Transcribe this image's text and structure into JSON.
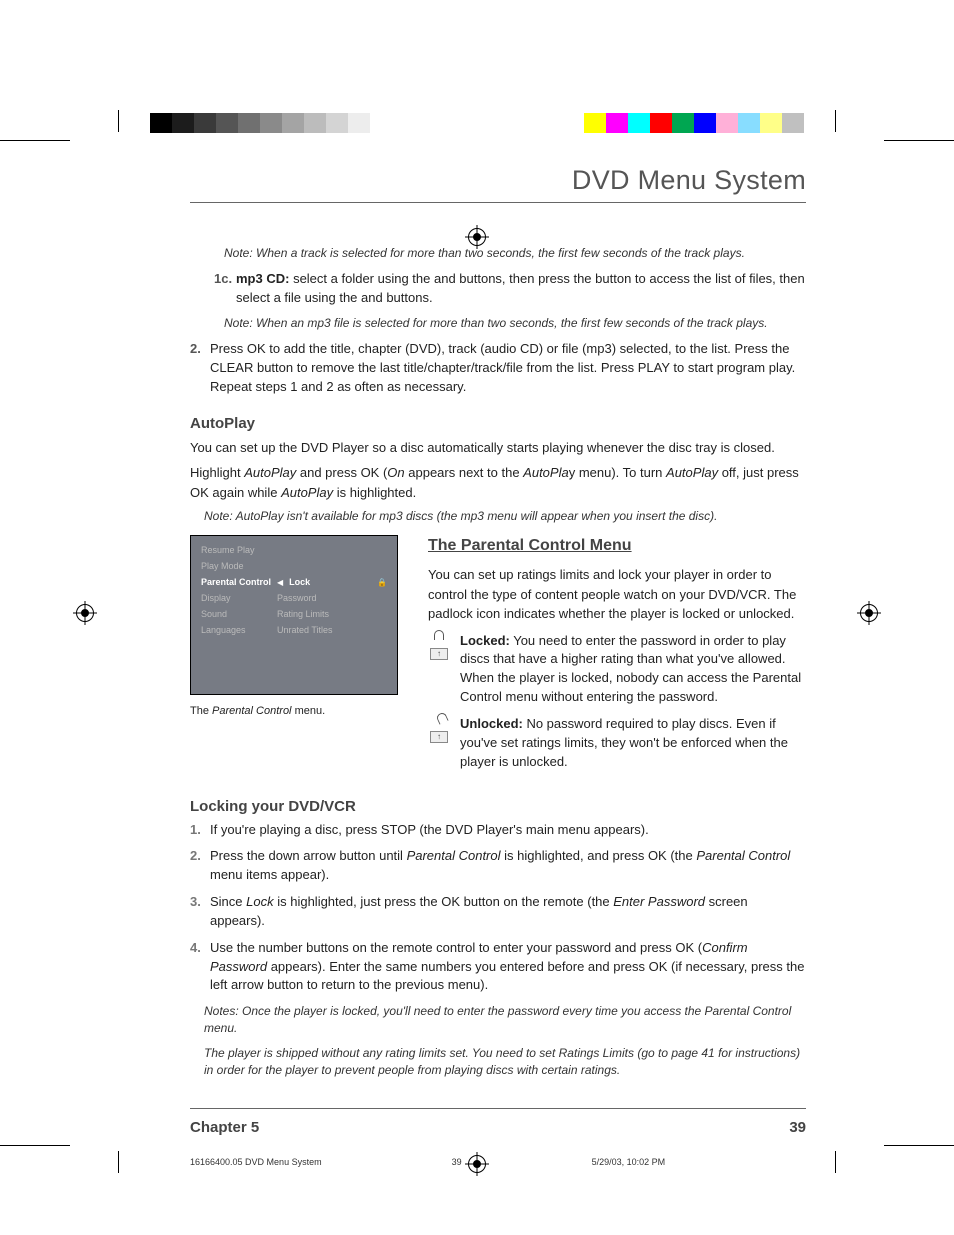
{
  "header": {
    "title": "DVD Menu System"
  },
  "intro": {
    "note1": "Note: When a track is selected for more than two seconds, the first few seconds of the track plays.",
    "step1c_label": "1c.",
    "step1c_pre": "mp3 CD:",
    "step1c_text": " select a folder using the and buttons, then press the button to access the list of files, then select a file using the and buttons.",
    "note2": "Note: When an mp3 file is selected for more than two seconds, the first few seconds of the track plays.",
    "step2_label": "2.",
    "step2_text": "Press OK to add the title, chapter (DVD), track (audio CD) or file (mp3) selected, to the list. Press the CLEAR button to remove the last title/chapter/track/file from the list. Press PLAY to start program play. Repeat steps 1 and 2 as often as necessary."
  },
  "autoplay": {
    "heading": "AutoPlay",
    "p1": "You can set up the DVD Player so a disc automatically starts playing whenever the disc tray is closed.",
    "p2_a": "Highlight ",
    "p2_b": "AutoPlay",
    "p2_c": " and press OK (",
    "p2_d": "On",
    "p2_e": " appears next to the ",
    "p2_f": "AutoPla",
    "p2_g": "y menu). To turn ",
    "p2_h": "AutoPlay",
    "p2_i": " off, just press OK again while ",
    "p2_j": "AutoPlay",
    "p2_k": " is highlighted.",
    "note": "Note: AutoPlay isn't available for mp3 discs (the mp3 menu will appear when you insert the disc)."
  },
  "menu_shot": {
    "items_left": [
      "Resume Play",
      "Play Mode",
      "Parental Control",
      "Display",
      "Sound",
      "Languages"
    ],
    "items_right": [
      "Lock",
      "Password",
      "Rating Limits",
      "Unrated Titles"
    ],
    "caption_a": "The ",
    "caption_b": "Parental Control",
    "caption_c": " menu."
  },
  "parental": {
    "heading": "The Parental Control Menu",
    "p1": "You can set up ratings limits and lock your player in order to control the type of content people watch on your DVD/VCR. The padlock icon indicates whether the player is locked or unlocked.",
    "locked_b": "Locked:",
    "locked_t": " You need to enter the password in order to play discs that have a higher rating than what you've allowed. When the player is locked, nobody can access the Parental Control menu without entering the password.",
    "unlocked_b": "Unlocked:",
    "unlocked_t": " No password required to play discs. Even if you've set ratings limits, they won't be enforced when the player is unlocked."
  },
  "locking": {
    "heading": "Locking your DVD/VCR",
    "s1n": "1.",
    "s1": "If you're playing a disc, press STOP (the DVD Player's main menu appears).",
    "s2n": "2.",
    "s2a": "Press the down arrow button until ",
    "s2b": "Parental Control",
    "s2c": " is highlighted, and press OK (the ",
    "s2d": "Parental Control",
    "s2e": " menu items appear).",
    "s3n": "3.",
    "s3a": "Since ",
    "s3b": "Lock",
    "s3c": " is highlighted, just press the OK button on the remote (the ",
    "s3d": "Enter Password",
    "s3e": " screen appears).",
    "s4n": "4.",
    "s4a": "Use the number buttons on the remote control to enter your password and press OK (",
    "s4b": "Confirm Password",
    "s4c": " appears). Enter the same numbers you entered before and press OK (if necessary, press the left arrow button to return to the previous menu).",
    "note1": "Notes: Once the player is locked, you'll need to enter the password every time you access the Parental Control menu.",
    "note2": "The player is shipped without any rating limits set. You need to set Ratings Limits (go to page 41 for instructions) in order for the player to prevent people from playing discs with certain ratings."
  },
  "footer": {
    "chapter": "Chapter 5",
    "page": "39"
  },
  "smallfooter": {
    "file": "16166400.05 DVD Menu System",
    "pg": "39",
    "date": "5/29/03, 10:02 PM"
  },
  "colors": {
    "grays": [
      "#000",
      "#1c1c1c",
      "#3a3a3a",
      "#555",
      "#707070",
      "#8a8a8a",
      "#a4a4a4",
      "#bcbcbc",
      "#d4d4d4",
      "#ededed"
    ],
    "hues": [
      "#ffff00",
      "#ff00ff",
      "#00ffff",
      "#ff0000",
      "#00a651",
      "#0000ff",
      "#ffb0d8",
      "#88ddff",
      "#ffff88",
      "#c0c0c0"
    ]
  }
}
